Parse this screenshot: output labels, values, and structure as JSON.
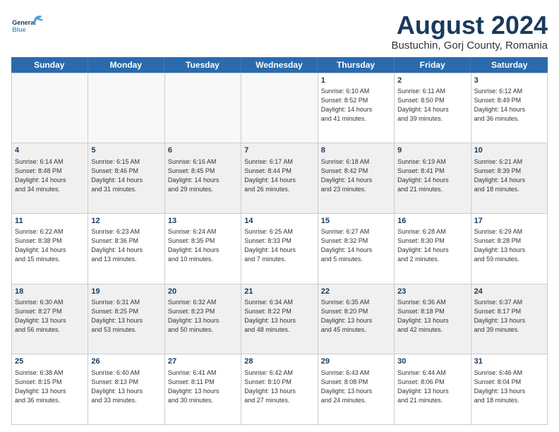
{
  "header": {
    "logo_general": "General",
    "logo_blue": "Blue",
    "main_title": "August 2024",
    "subtitle": "Bustuchin, Gorj County, Romania"
  },
  "days_of_week": [
    "Sunday",
    "Monday",
    "Tuesday",
    "Wednesday",
    "Thursday",
    "Friday",
    "Saturday"
  ],
  "weeks": [
    [
      {
        "day": "",
        "text": ""
      },
      {
        "day": "",
        "text": ""
      },
      {
        "day": "",
        "text": ""
      },
      {
        "day": "",
        "text": ""
      },
      {
        "day": "1",
        "text": "Sunrise: 6:10 AM\nSunset: 8:52 PM\nDaylight: 14 hours\nand 41 minutes."
      },
      {
        "day": "2",
        "text": "Sunrise: 6:11 AM\nSunset: 8:50 PM\nDaylight: 14 hours\nand 39 minutes."
      },
      {
        "day": "3",
        "text": "Sunrise: 6:12 AM\nSunset: 8:49 PM\nDaylight: 14 hours\nand 36 minutes."
      }
    ],
    [
      {
        "day": "4",
        "text": "Sunrise: 6:14 AM\nSunset: 8:48 PM\nDaylight: 14 hours\nand 34 minutes."
      },
      {
        "day": "5",
        "text": "Sunrise: 6:15 AM\nSunset: 8:46 PM\nDaylight: 14 hours\nand 31 minutes."
      },
      {
        "day": "6",
        "text": "Sunrise: 6:16 AM\nSunset: 8:45 PM\nDaylight: 14 hours\nand 29 minutes."
      },
      {
        "day": "7",
        "text": "Sunrise: 6:17 AM\nSunset: 8:44 PM\nDaylight: 14 hours\nand 26 minutes."
      },
      {
        "day": "8",
        "text": "Sunrise: 6:18 AM\nSunset: 8:42 PM\nDaylight: 14 hours\nand 23 minutes."
      },
      {
        "day": "9",
        "text": "Sunrise: 6:19 AM\nSunset: 8:41 PM\nDaylight: 14 hours\nand 21 minutes."
      },
      {
        "day": "10",
        "text": "Sunrise: 6:21 AM\nSunset: 8:39 PM\nDaylight: 14 hours\nand 18 minutes."
      }
    ],
    [
      {
        "day": "11",
        "text": "Sunrise: 6:22 AM\nSunset: 8:38 PM\nDaylight: 14 hours\nand 15 minutes."
      },
      {
        "day": "12",
        "text": "Sunrise: 6:23 AM\nSunset: 8:36 PM\nDaylight: 14 hours\nand 13 minutes."
      },
      {
        "day": "13",
        "text": "Sunrise: 6:24 AM\nSunset: 8:35 PM\nDaylight: 14 hours\nand 10 minutes."
      },
      {
        "day": "14",
        "text": "Sunrise: 6:25 AM\nSunset: 8:33 PM\nDaylight: 14 hours\nand 7 minutes."
      },
      {
        "day": "15",
        "text": "Sunrise: 6:27 AM\nSunset: 8:32 PM\nDaylight: 14 hours\nand 5 minutes."
      },
      {
        "day": "16",
        "text": "Sunrise: 6:28 AM\nSunset: 8:30 PM\nDaylight: 14 hours\nand 2 minutes."
      },
      {
        "day": "17",
        "text": "Sunrise: 6:29 AM\nSunset: 8:28 PM\nDaylight: 13 hours\nand 59 minutes."
      }
    ],
    [
      {
        "day": "18",
        "text": "Sunrise: 6:30 AM\nSunset: 8:27 PM\nDaylight: 13 hours\nand 56 minutes."
      },
      {
        "day": "19",
        "text": "Sunrise: 6:31 AM\nSunset: 8:25 PM\nDaylight: 13 hours\nand 53 minutes."
      },
      {
        "day": "20",
        "text": "Sunrise: 6:32 AM\nSunset: 8:23 PM\nDaylight: 13 hours\nand 50 minutes."
      },
      {
        "day": "21",
        "text": "Sunrise: 6:34 AM\nSunset: 8:22 PM\nDaylight: 13 hours\nand 48 minutes."
      },
      {
        "day": "22",
        "text": "Sunrise: 6:35 AM\nSunset: 8:20 PM\nDaylight: 13 hours\nand 45 minutes."
      },
      {
        "day": "23",
        "text": "Sunrise: 6:36 AM\nSunset: 8:18 PM\nDaylight: 13 hours\nand 42 minutes."
      },
      {
        "day": "24",
        "text": "Sunrise: 6:37 AM\nSunset: 8:17 PM\nDaylight: 13 hours\nand 39 minutes."
      }
    ],
    [
      {
        "day": "25",
        "text": "Sunrise: 6:38 AM\nSunset: 8:15 PM\nDaylight: 13 hours\nand 36 minutes."
      },
      {
        "day": "26",
        "text": "Sunrise: 6:40 AM\nSunset: 8:13 PM\nDaylight: 13 hours\nand 33 minutes."
      },
      {
        "day": "27",
        "text": "Sunrise: 6:41 AM\nSunset: 8:11 PM\nDaylight: 13 hours\nand 30 minutes."
      },
      {
        "day": "28",
        "text": "Sunrise: 6:42 AM\nSunset: 8:10 PM\nDaylight: 13 hours\nand 27 minutes."
      },
      {
        "day": "29",
        "text": "Sunrise: 6:43 AM\nSunset: 8:08 PM\nDaylight: 13 hours\nand 24 minutes."
      },
      {
        "day": "30",
        "text": "Sunrise: 6:44 AM\nSunset: 8:06 PM\nDaylight: 13 hours\nand 21 minutes."
      },
      {
        "day": "31",
        "text": "Sunrise: 6:46 AM\nSunset: 8:04 PM\nDaylight: 13 hours\nand 18 minutes."
      }
    ]
  ]
}
